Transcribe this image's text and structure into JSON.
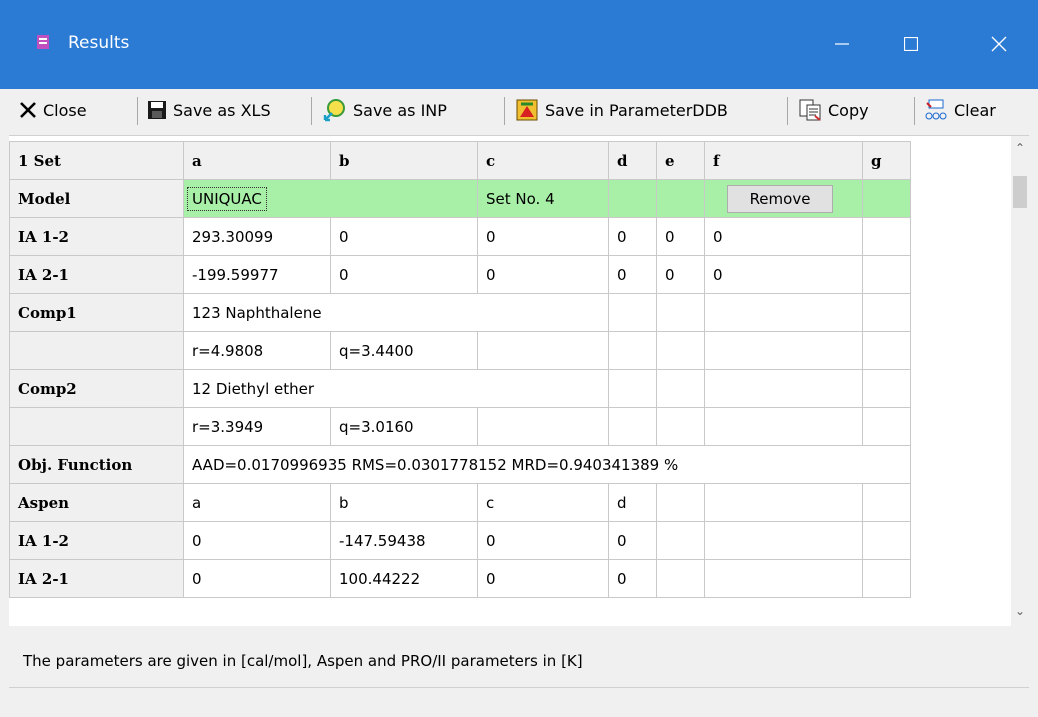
{
  "window": {
    "title": "Results"
  },
  "toolbar": {
    "close": "Close",
    "save_xls": "Save as XLS",
    "save_inp": "Save as INP",
    "save_param": "Save in ParameterDDB",
    "copy": "Copy",
    "clear": "Clear"
  },
  "grid": {
    "columns": [
      "1 Set",
      "a",
      "b",
      "c",
      "d",
      "e",
      "f",
      "g"
    ],
    "model": {
      "label": "Model",
      "name": "UNIQUAC",
      "set": "Set No. 4",
      "remove": "Remove"
    },
    "ia12": {
      "label": "IA 1-2",
      "values": [
        "293.30099",
        "0",
        "0",
        "0",
        "0",
        "0"
      ]
    },
    "ia21": {
      "label": "IA 2-1",
      "values": [
        "-199.59977",
        "0",
        "0",
        "0",
        "0",
        "0"
      ]
    },
    "comp1": {
      "label": "Comp1",
      "name": "123 Naphthalene",
      "r": "r=4.9808",
      "q": "q=3.4400"
    },
    "comp2": {
      "label": "Comp2",
      "name": "12 Diethyl ether",
      "r": "r=3.3949",
      "q": "q=3.0160"
    },
    "obj": {
      "label": "Obj. Function",
      "value": "AAD=0.0170996935 RMS=0.0301778152 MRD=0.940341389 %"
    },
    "aspen": {
      "label": "Aspen",
      "cols": [
        "a",
        "b",
        "c",
        "d"
      ]
    },
    "aspen_ia12": {
      "label": "IA 1-2",
      "values": [
        "0",
        "-147.59438",
        "0",
        "0"
      ]
    },
    "aspen_ia21": {
      "label": "IA 2-1",
      "values": [
        "0",
        "100.44222",
        "0",
        "0"
      ]
    }
  },
  "status": {
    "message": "The parameters are given in [cal/mol], Aspen and PRO/II parameters in [K]"
  }
}
